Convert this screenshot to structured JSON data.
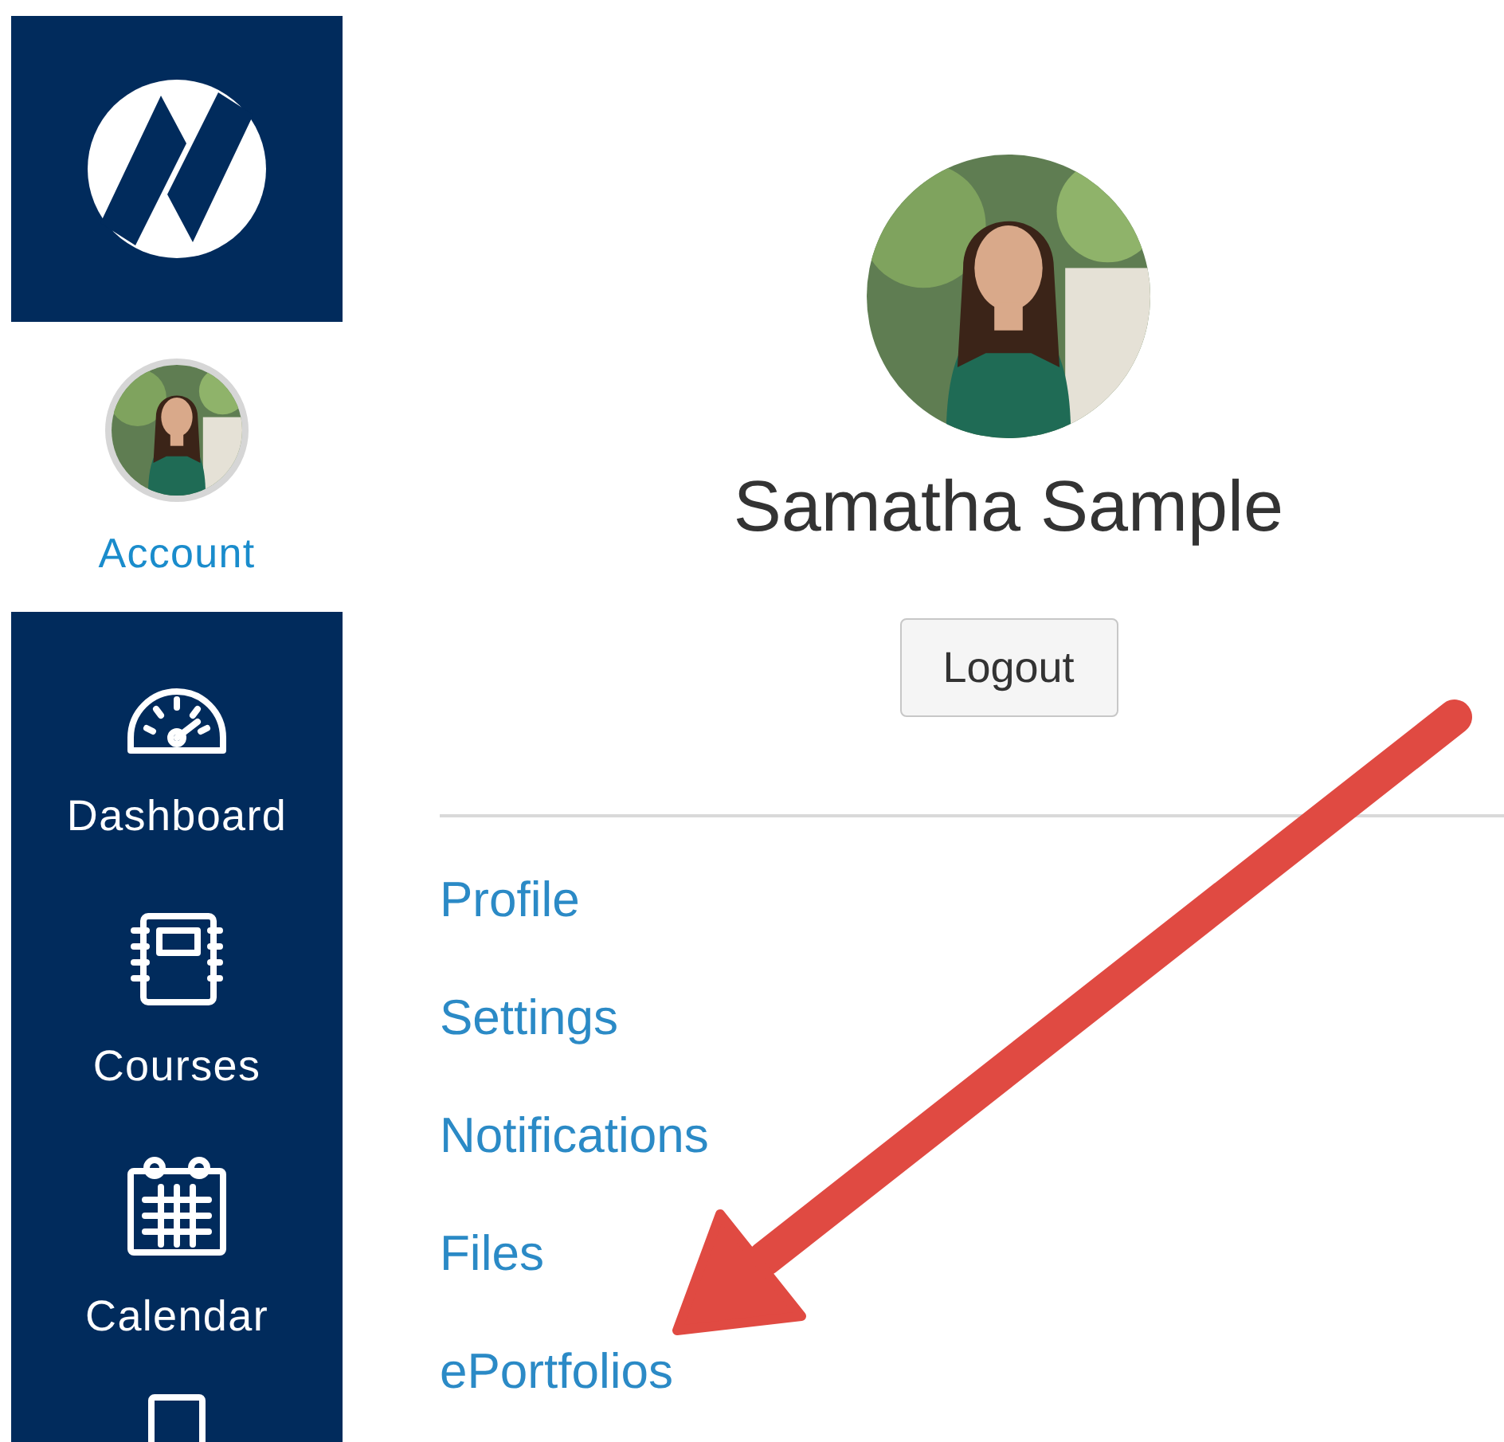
{
  "sidebar": {
    "account": {
      "label": "Account",
      "selected": true
    },
    "items": [
      {
        "label": "Dashboard",
        "selected": false
      },
      {
        "label": "Courses",
        "selected": false
      },
      {
        "label": "Calendar",
        "selected": false
      }
    ]
  },
  "profile": {
    "name": "Samatha Sample",
    "logout_button": "Logout"
  },
  "links": [
    "Profile",
    "Settings",
    "Notifications",
    "Files",
    "ePortfolios"
  ],
  "annotation": {
    "kind": "arrow",
    "color": "#e04a42"
  }
}
